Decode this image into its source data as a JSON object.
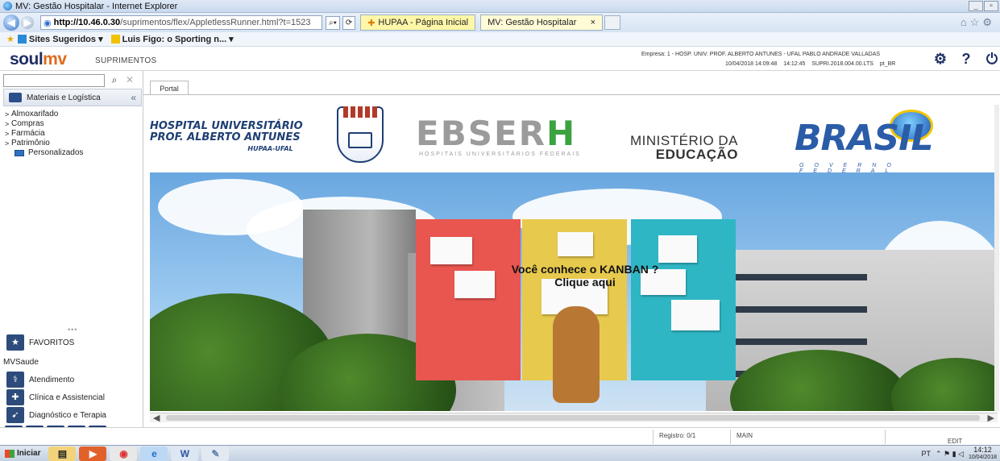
{
  "window": {
    "title": "MV: Gestão Hospitalar - Internet Explorer",
    "controls": [
      "_",
      "▫"
    ]
  },
  "browser": {
    "url_host": "http://10.46.0.30",
    "url_path": "/suprimentos/flex/AppletlessRunner.html?t=1523",
    "tabs": [
      {
        "label": "HUPAA - Página Inicial",
        "active": false
      },
      {
        "label": "MV: Gestão Hospitalar",
        "active": true,
        "close": "×"
      }
    ],
    "favorites": {
      "suggested": "Sites Sugeridos ▾",
      "item": "Luis Figo: o Sporting n... ▾"
    }
  },
  "header": {
    "logo_soul": "soul",
    "logo_mv": "mv",
    "module": "SUPRIMENTOS",
    "company": "Empresa: 1 - HOSP. UNIV. PROF. ALBERTO ANTUNES - UFAL   PABLO ANDRADE VALLADAS",
    "date": "10/04/2018 14:09:48",
    "time": "14:12:45",
    "version": "SUPRI.2018.004.00.LTS",
    "locale": "pt_BR",
    "help": "?"
  },
  "sidebar": {
    "search_placeholder": "",
    "menu_title": "Materiais e Logística",
    "collapse": "«",
    "items": [
      {
        "label": "Almoxarifado",
        "chevron": ">"
      },
      {
        "label": "Compras",
        "chevron": ">"
      },
      {
        "label": "Farmácia",
        "chevron": ">"
      },
      {
        "label": "Patrimônio",
        "chevron": ">"
      },
      {
        "label": "Personalizados",
        "chevron": ""
      }
    ],
    "favorites": "FAVORITOS",
    "group": "MVSaude",
    "sections": [
      "Atendimento",
      "Clínica e Assistencial",
      "Diagnóstico e Terapia"
    ],
    "bottom_tools": [
      "S"
    ]
  },
  "content": {
    "tab_label": "Portal",
    "banner": {
      "hospital_line1": "HOSPITAL UNIVERSITÁRIO",
      "hospital_line2": "PROF. ALBERTO ANTUNES",
      "hospital_line3": "HUPAA-UFAL",
      "ebserh_main": "EBSER",
      "ebserh_h": "H",
      "ebserh_sub": "HOSPITAIS UNIVERSITÁRIOS FEDERAIS",
      "ministerio_line1": "MINISTÉRIO DA",
      "ministerio_line2": "EDUCAÇÃO",
      "brasil": "BRASIL",
      "governo": "GOVERNO FEDERAL"
    },
    "kanban_line1": "Você conhece o KANBAN ?",
    "kanban_line2": "Clique aqui"
  },
  "statusbar": {
    "registro": "Registro: 0/1",
    "main": "MAIN",
    "edit": "EDIT"
  },
  "taskbar": {
    "start": "Iniciar",
    "lang": "PT",
    "time": "14:12",
    "date": "10/04/2018"
  }
}
